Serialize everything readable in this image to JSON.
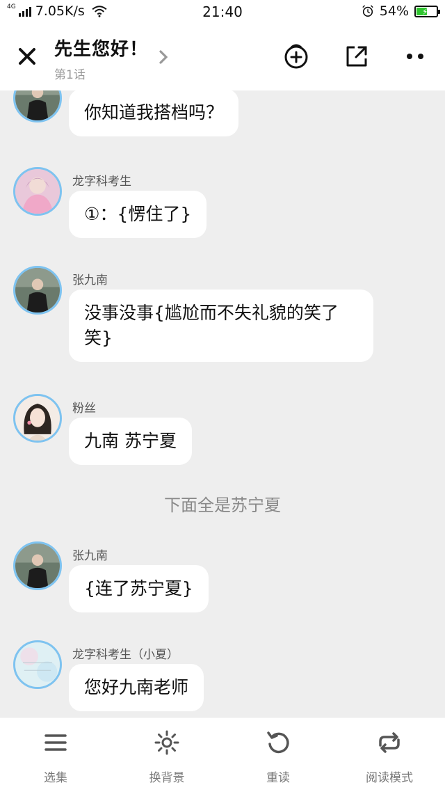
{
  "status_bar": {
    "network": "4G",
    "speed": "7.05K/s",
    "time": "21:40",
    "battery": "54%",
    "battery_level": 0.54,
    "icons": [
      "signal-icon",
      "wifi-icon",
      "alarm-icon",
      "battery-icon"
    ]
  },
  "header": {
    "title": "先生您好！",
    "subtitle": "第1话",
    "icons": [
      "close-icon",
      "chevron-right-icon",
      "add-badge-icon",
      "share-icon",
      "more-icon"
    ]
  },
  "chat": {
    "messages": [
      {
        "type": "message",
        "name": "",
        "text": "你知道我搭档吗？",
        "avatar": "male-avatar"
      },
      {
        "type": "message",
        "name": "龙字科考生",
        "text": "①：{愣住了}",
        "avatar": "pink-girl-avatar"
      },
      {
        "type": "message",
        "name": "张九南",
        "text": "没事没事{尴尬而不失礼貌的笑了笑}",
        "avatar": "male-avatar"
      },
      {
        "type": "message",
        "name": "粉丝",
        "text": "九南 苏宁夏",
        "avatar": "girl-avatar"
      },
      {
        "type": "narration",
        "text": "下面全是苏宁夏"
      },
      {
        "type": "message",
        "name": "张九南",
        "text": "{连了苏宁夏}",
        "avatar": "male-avatar"
      },
      {
        "type": "message",
        "name": "龙字科考生（小夏）",
        "text": "您好九南老师",
        "avatar": "light-text-avatar"
      }
    ]
  },
  "bottom_nav": {
    "items": [
      {
        "label": "选集",
        "icon": "menu-icon"
      },
      {
        "label": "换背景",
        "icon": "sun-icon"
      },
      {
        "label": "重读",
        "icon": "replay-icon"
      },
      {
        "label": "阅读模式",
        "icon": "loop-icon"
      }
    ]
  },
  "colors": {
    "chat_background": "#eeeeee",
    "avatar_border": "#7ec3f0",
    "battery_green": "#2fc52f"
  }
}
